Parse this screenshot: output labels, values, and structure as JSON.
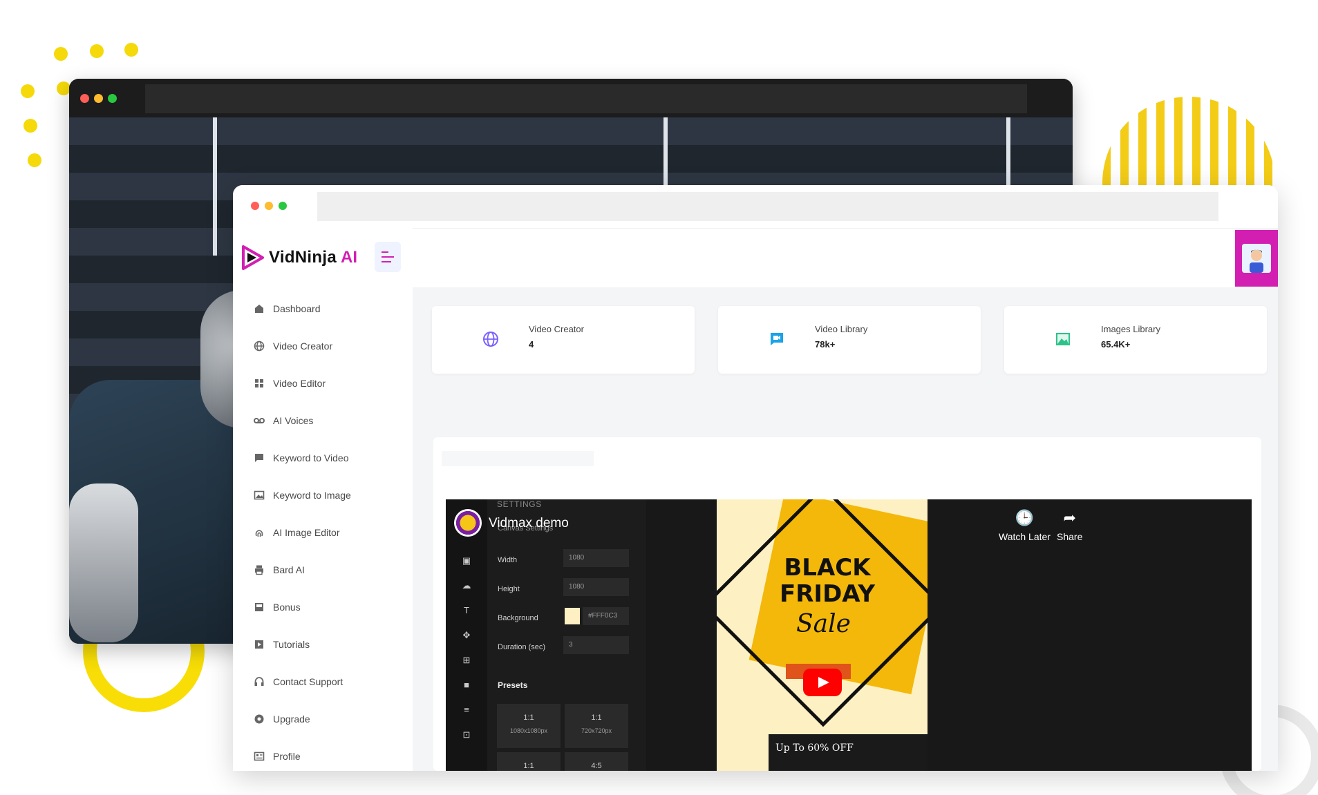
{
  "app": {
    "name": "VidNinja",
    "name_suffix": "AI"
  },
  "sidebar": {
    "items": [
      {
        "label": "Dashboard",
        "icon": "home-icon"
      },
      {
        "label": "Video Creator",
        "icon": "globe-icon"
      },
      {
        "label": "Video Editor",
        "icon": "grid-icon"
      },
      {
        "label": "AI Voices",
        "icon": "voicemail-icon"
      },
      {
        "label": "Keyword to Video",
        "icon": "chat-icon"
      },
      {
        "label": "Keyword to Image",
        "icon": "image-icon"
      },
      {
        "label": "AI Image Editor",
        "icon": "fingerprint-icon"
      },
      {
        "label": "Bard AI",
        "icon": "printer-icon"
      },
      {
        "label": "Bonus",
        "icon": "inbox-icon"
      },
      {
        "label": "Tutorials",
        "icon": "play-icon"
      },
      {
        "label": "Contact Support",
        "icon": "headset-icon"
      },
      {
        "label": "Upgrade",
        "icon": "upgrade-icon"
      },
      {
        "label": "Profile",
        "icon": "profile-card-icon"
      }
    ]
  },
  "stats": [
    {
      "title": "Video Creator",
      "value": "4",
      "icon": "globe-icon"
    },
    {
      "title": "Video Library",
      "value": "78k+",
      "icon": "video-chat-icon"
    },
    {
      "title": "Images Library",
      "value": "65.4K+",
      "icon": "image-icon"
    }
  ],
  "video": {
    "title": "Vidmax demo",
    "watch_later": "Watch Later",
    "share": "Share",
    "editor": {
      "settings_header": "SETTINGS",
      "canvas_settings": "Canvas Settings",
      "fields": [
        {
          "label": "Width",
          "value": "1080"
        },
        {
          "label": "Height",
          "value": "1080"
        },
        {
          "label": "Background",
          "value": "#FFF0C3"
        },
        {
          "label": "Duration (sec)",
          "value": "3"
        }
      ],
      "presets_label": "Presets",
      "presets": [
        {
          "ratio": "1:1",
          "size": "1080x1080px"
        },
        {
          "ratio": "1:1",
          "size": "720x720px"
        },
        {
          "ratio": "1:1",
          "size": ""
        },
        {
          "ratio": "4:5",
          "size": ""
        }
      ]
    },
    "poster": {
      "headline": "BLACK FRIDAY",
      "script": "Sale",
      "footer": "Up To 60% OFF"
    }
  },
  "colors": {
    "brand_magenta": "#d21fb2",
    "accent_yellow": "#f8de06",
    "youtube_red": "#ff0000"
  }
}
